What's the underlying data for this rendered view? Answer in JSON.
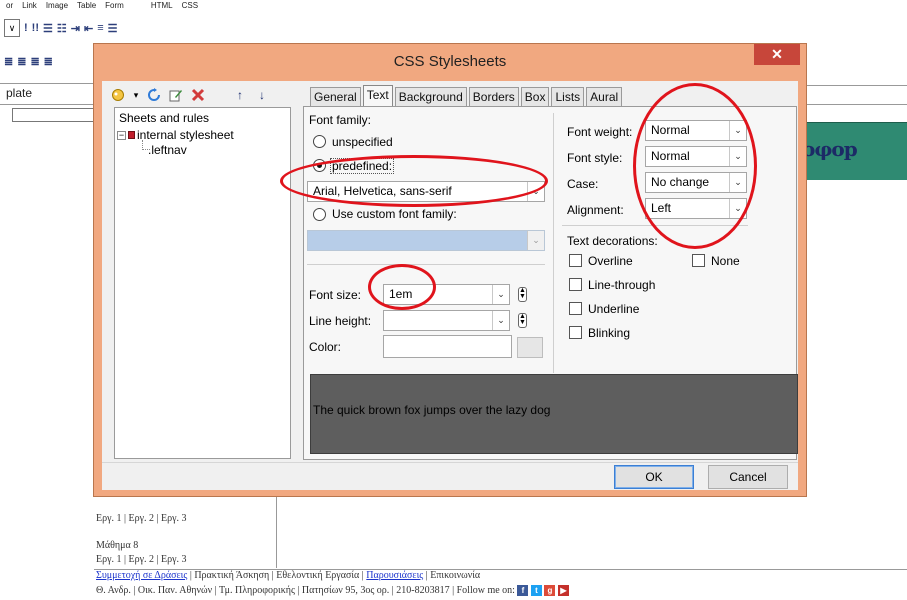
{
  "background": {
    "menu": [
      "or",
      "Link",
      "Image",
      "Table",
      "Form",
      "HTML",
      "CSS"
    ],
    "toolbar_row1": [
      "!",
      "!!"
    ],
    "template_label": "plate",
    "bottom_lines": {
      "line1": "Εργ. 1 | Εργ. 2 | Εργ. 3",
      "line2": "Μάθημα 8",
      "line3": "Εργ. 1 | Εργ. 2 | Εργ. 3",
      "links": {
        "l1": "Συμμετοχή σε Δράσεις",
        "t1": " | Πρακτική Άσκηση | Εθελοντική Εργασία | ",
        "l2": "Παρουσιάσεις",
        "t2": " | Επικοινωνία"
      },
      "footer": "Θ. Ανδρ. | Οικ. Παν. Αθηνών | Τμ. Πληροφορικής | Πατησίων 95, 3ος ορ. | 210-8203817 | Follow me on:"
    }
  },
  "dialog": {
    "title": "CSS Stylesheets",
    "close": "✕",
    "left_pane": {
      "tree_header": "Sheets and rules",
      "stylesheet": "internal stylesheet",
      "rule": ".leftnav"
    },
    "tabs": [
      "General",
      "Text",
      "Background",
      "Borders",
      "Box",
      "Lists",
      "Aural"
    ],
    "active_tab": "Text",
    "font_family": {
      "label": "Font family:",
      "opt_unspecified": "unspecified",
      "opt_predefined": "predefined:",
      "predefined_value": "Arial, Helvetica, sans-serif",
      "opt_custom": "Use custom font family:"
    },
    "font_size": {
      "label": "Font size:",
      "value": "1em"
    },
    "line_height": {
      "label": "Line height:",
      "value": ""
    },
    "color": {
      "label": "Color:",
      "value": ""
    },
    "font_weight": {
      "label": "Font weight:",
      "value": "Normal"
    },
    "font_style": {
      "label": "Font style:",
      "value": "Normal"
    },
    "case": {
      "label": "Case:",
      "value": "No change"
    },
    "alignment": {
      "label": "Alignment:",
      "value": "Left"
    },
    "text_decorations": {
      "label": "Text decorations:",
      "overline": "Overline",
      "none": "None",
      "line_through": "Line-through",
      "underline": "Underline",
      "blinking": "Blinking"
    },
    "preview_text": "The quick brown fox jumps over the lazy dog",
    "ok": "OK",
    "cancel": "Cancel"
  },
  "colors": {
    "dialog_frame": "#f1a880",
    "close_button": "#c7463a",
    "annotation": "#e0141c",
    "preview_bg": "#5e5e5e"
  }
}
